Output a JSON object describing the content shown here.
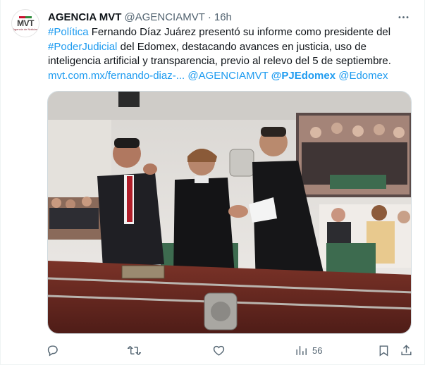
{
  "tweet": {
    "author_name": "AGENCIA MVT",
    "author_handle": "@AGENCIAMVT",
    "separator": "·",
    "time": "16h",
    "avatar": {
      "logo_text": "MVT",
      "logo_subtext": "Agencia de Noticias",
      "icon": "agency-logo"
    },
    "more_icon": "more-horizontal-icon",
    "body": {
      "hashtag_1": "#Política",
      "text_1": " Fernando Díaz Juárez presentó su informe como presidente del ",
      "hashtag_2": "#PoderJudicial",
      "text_2": " del Edomex, destacando avances en justicia, uso de inteligencia artificial y transparencia, previo al relevo del 5 de septiembre.",
      "url": "mvt.com.mx/fernando-diaz-...",
      "mention_1": "@AGENCIAMVT",
      "mention_2": "@PJEdomex",
      "mention_3": "@Edomex"
    },
    "media": {
      "description_icon": "photo-image",
      "colors": {
        "wood": "#6b2a22",
        "wall": "#ece9e6",
        "green_seat": "#3d6b4f"
      }
    },
    "actions": {
      "reply": {
        "icon": "reply-icon",
        "count": ""
      },
      "retweet": {
        "icon": "retweet-icon",
        "count": ""
      },
      "like": {
        "icon": "like-icon",
        "count": ""
      },
      "views": {
        "icon": "views-icon",
        "count": "56"
      },
      "bookmark": {
        "icon": "bookmark-icon"
      },
      "share": {
        "icon": "share-icon"
      }
    },
    "colors": {
      "link": "#1d9bf0",
      "muted": "#536471",
      "text": "#0f1419"
    }
  }
}
